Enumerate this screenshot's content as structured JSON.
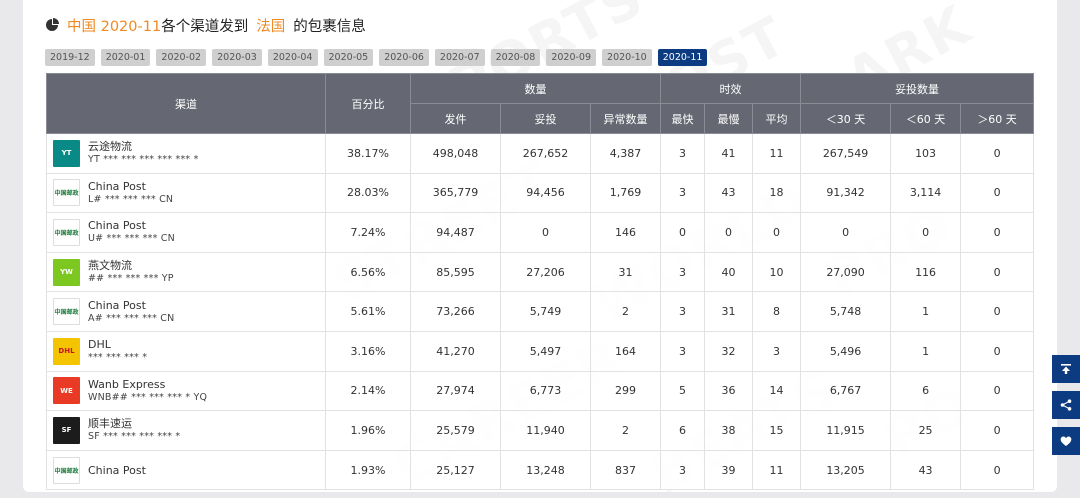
{
  "title": {
    "prefix": "中国 2020-11",
    "middle": "各个渠道发到",
    "country": "法国",
    "suffix": "的包裹信息"
  },
  "months": [
    "2019-12",
    "2020-01",
    "2020-02",
    "2020-03",
    "2020-04",
    "2020-05",
    "2020-06",
    "2020-07",
    "2020-08",
    "2020-09",
    "2020-10",
    "2020-11"
  ],
  "active_month": "2020-11",
  "table": {
    "group_headers": {
      "quantity": "数量",
      "timeliness": "时效",
      "delivered_count": "妥投数量"
    },
    "headers": {
      "channel": "渠道",
      "percent": "百分比",
      "shipped": "发件",
      "delivered": "妥投",
      "abnormal": "异常数量",
      "fastest": "最快",
      "slowest": "最慢",
      "average": "平均",
      "lt30": "＜30 天",
      "lt60": "＜60 天",
      "gt60": "＞60 天"
    },
    "rows": [
      {
        "name": "云途物流",
        "track": "YT *** *** *** *** *** *",
        "logo_color": "#0a8a86",
        "logo_text": "YT",
        "percent": "38.17%",
        "shipped": "498,048",
        "delivered": "267,652",
        "abnormal": "4,387",
        "fastest": "3",
        "slowest": "41",
        "average": "11",
        "lt30": "267,549",
        "lt60": "103",
        "gt60": "0"
      },
      {
        "name": "China Post",
        "track": "L# *** *** *** CN",
        "logo_color": "#ffffff",
        "logo_text": "中国邮政",
        "percent": "28.03%",
        "shipped": "365,779",
        "delivered": "94,456",
        "abnormal": "1,769",
        "fastest": "3",
        "slowest": "43",
        "average": "18",
        "lt30": "91,342",
        "lt60": "3,114",
        "gt60": "0"
      },
      {
        "name": "China Post",
        "track": "U# *** *** *** CN",
        "logo_color": "#ffffff",
        "logo_text": "中国邮政",
        "percent": "7.24%",
        "shipped": "94,487",
        "delivered": "0",
        "abnormal": "146",
        "fastest": "0",
        "slowest": "0",
        "average": "0",
        "lt30": "0",
        "lt60": "0",
        "gt60": "0"
      },
      {
        "name": "燕文物流",
        "track": "## *** *** *** YP",
        "logo_color": "#7cc820",
        "logo_text": "YW",
        "percent": "6.56%",
        "shipped": "85,595",
        "delivered": "27,206",
        "abnormal": "31",
        "fastest": "3",
        "slowest": "40",
        "average": "10",
        "lt30": "27,090",
        "lt60": "116",
        "gt60": "0"
      },
      {
        "name": "China Post",
        "track": "A# *** *** *** CN",
        "logo_color": "#ffffff",
        "logo_text": "中国邮政",
        "percent": "5.61%",
        "shipped": "73,266",
        "delivered": "5,749",
        "abnormal": "2",
        "fastest": "3",
        "slowest": "31",
        "average": "8",
        "lt30": "5,748",
        "lt60": "1",
        "gt60": "0"
      },
      {
        "name": "DHL",
        "track": "*** *** *** *",
        "logo_color": "#f5c400",
        "logo_text": "DHL",
        "percent": "3.16%",
        "shipped": "41,270",
        "delivered": "5,497",
        "abnormal": "164",
        "fastest": "3",
        "slowest": "32",
        "average": "3",
        "lt30": "5,496",
        "lt60": "1",
        "gt60": "0"
      },
      {
        "name": "Wanb Express",
        "track": "WNB## *** *** *** * YQ",
        "logo_color": "#e83a24",
        "logo_text": "WE",
        "percent": "2.14%",
        "shipped": "27,974",
        "delivered": "6,773",
        "abnormal": "299",
        "fastest": "5",
        "slowest": "36",
        "average": "14",
        "lt30": "6,767",
        "lt60": "6",
        "gt60": "0"
      },
      {
        "name": "顺丰速运",
        "track": "SF *** *** *** *** *",
        "logo_color": "#1c1c1c",
        "logo_text": "SF",
        "percent": "1.96%",
        "shipped": "25,579",
        "delivered": "11,940",
        "abnormal": "2",
        "fastest": "6",
        "slowest": "38",
        "average": "15",
        "lt30": "11,915",
        "lt60": "25",
        "gt60": "0"
      },
      {
        "name": "China Post",
        "track": "",
        "logo_color": "#ffffff",
        "logo_text": "中国邮政",
        "percent": "1.93%",
        "shipped": "25,127",
        "delivered": "13,248",
        "abnormal": "837",
        "fastest": "3",
        "slowest": "39",
        "average": "11",
        "lt30": "13,205",
        "lt60": "43",
        "gt60": "0"
      }
    ]
  },
  "side_buttons": [
    {
      "icon": "back-to-top-icon"
    },
    {
      "icon": "share-icon"
    },
    {
      "icon": "heart-icon"
    }
  ],
  "colors": {
    "accent_orange": "#f08a24",
    "primary_blue": "#0d3b82",
    "header_gray": "#656872"
  }
}
